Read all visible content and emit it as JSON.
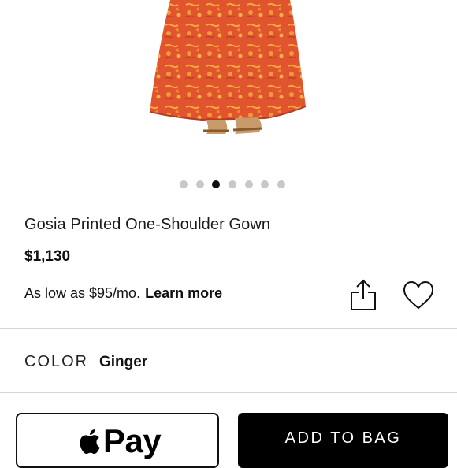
{
  "product": {
    "title": "Gosia Printed One-Shoulder Gown",
    "price": "$1,130",
    "financing_text": "As low as $95/mo.",
    "financing_link": "Learn more"
  },
  "gallery": {
    "image_count": 7,
    "active_index": 2,
    "image_colors": {
      "dress": "#e0552e",
      "dress_shade": "#c2402a",
      "pattern": "#f29a3a"
    }
  },
  "actions": {
    "share_icon": "share-icon",
    "favorite_icon": "heart-icon"
  },
  "color": {
    "label": "COLOR",
    "value": "Ginger"
  },
  "buttons": {
    "apple_pay_label": "Pay",
    "apple_pay_icon": "apple-logo-icon",
    "add_to_bag": "ADD TO BAG"
  }
}
